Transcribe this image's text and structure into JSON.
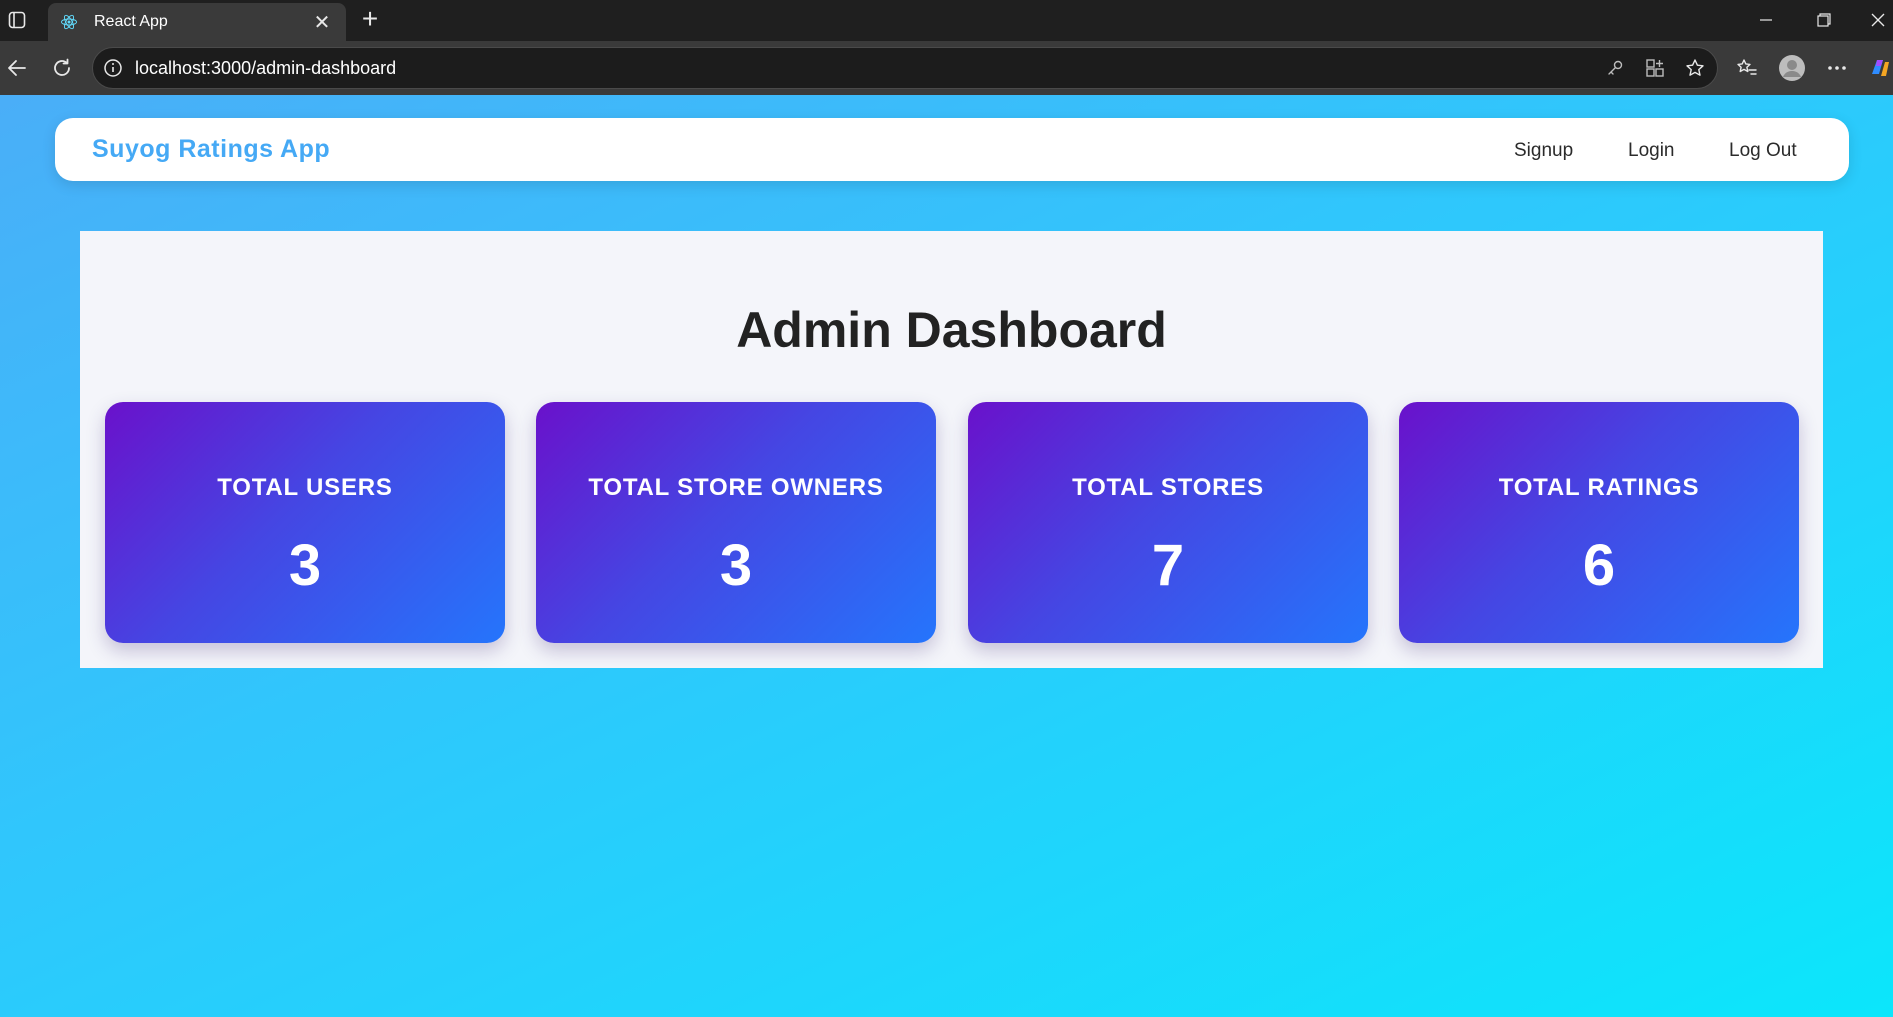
{
  "browser": {
    "tab_title": "React App",
    "url": "localhost:3000/admin-dashboard",
    "icons": [
      "tab-actions-icon",
      "react-favicon-icon",
      "close-icon",
      "new-tab-icon",
      "minimize-icon",
      "restore-icon",
      "window-close-icon",
      "back-icon",
      "reload-icon",
      "info-icon",
      "key-icon",
      "app-grid-icon",
      "star-icon",
      "favorites-icon",
      "profile-avatar-icon",
      "more-icon",
      "copilot-icon"
    ]
  },
  "navbar": {
    "brand": "Suyog Ratings App",
    "links": {
      "signup": "Signup",
      "login": "Login",
      "logout": "Log Out"
    }
  },
  "dashboard": {
    "title": "Admin Dashboard",
    "cards": [
      {
        "label": "TOTAL USERS",
        "value": "3"
      },
      {
        "label": "TOTAL STORE OWNERS",
        "value": "3"
      },
      {
        "label": "TOTAL STORES",
        "value": "7"
      },
      {
        "label": "TOTAL RATINGS",
        "value": "6"
      }
    ]
  },
  "colors": {
    "brand": "#45a9f5",
    "card_gradient_start": "#6a11cb",
    "card_gradient_end": "#2575fc",
    "page_gradient_start": "#4aaef8",
    "page_gradient_end": "#0be6fb"
  }
}
